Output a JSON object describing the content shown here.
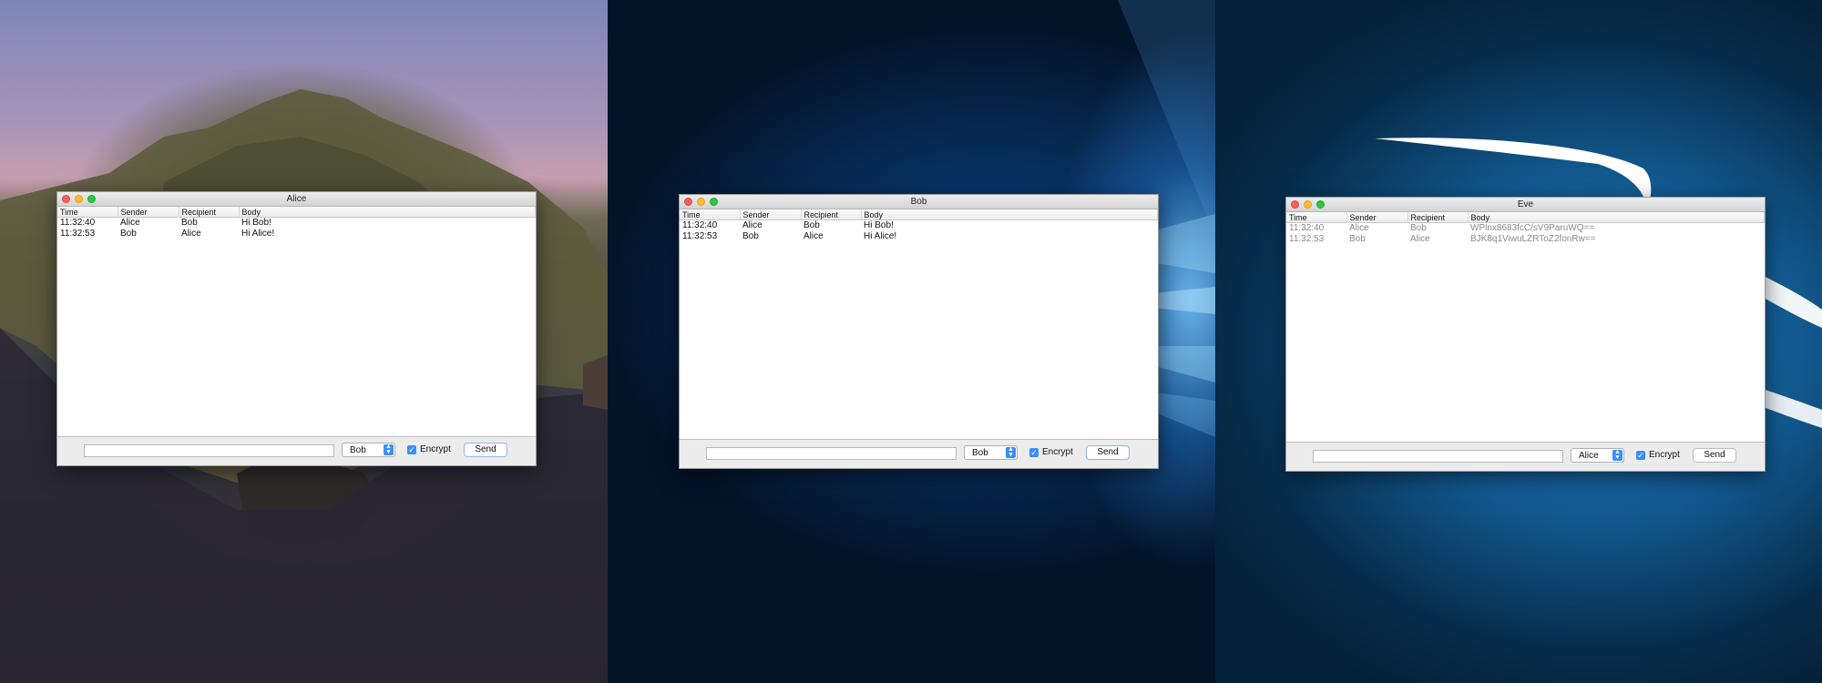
{
  "columns": [
    "Time",
    "Sender",
    "Recipient",
    "Body"
  ],
  "windows": {
    "alice": {
      "title": "Alice",
      "messages": [
        {
          "time": "11:32:40",
          "sender": "Alice",
          "recipient": "Bob",
          "body": "Hi Bob!"
        },
        {
          "time": "11:32:53",
          "sender": "Bob",
          "recipient": "Alice",
          "body": "Hi Alice!"
        }
      ],
      "input_value": "",
      "recipient_select": "Bob",
      "encrypt_label": "Encrypt",
      "encrypt_checked": true,
      "send_label": "Send"
    },
    "bob": {
      "title": "Bob",
      "messages": [
        {
          "time": "11:32:40",
          "sender": "Alice",
          "recipient": "Bob",
          "body": "Hi Bob!"
        },
        {
          "time": "11:32:53",
          "sender": "Bob",
          "recipient": "Alice",
          "body": "Hi Alice!"
        }
      ],
      "input_value": "",
      "recipient_select": "Bob",
      "encrypt_label": "Encrypt",
      "encrypt_checked": true,
      "send_label": "Send"
    },
    "eve": {
      "title": "Eve",
      "messages": [
        {
          "time": "11:32:40",
          "sender": "Alice",
          "recipient": "Bob",
          "body": "WPlnx8683fcC/sV9ParuWQ=="
        },
        {
          "time": "11:32:53",
          "sender": "Bob",
          "recipient": "Alice",
          "body": "BJK8q1ViwuLZRToZ2fonRw=="
        }
      ],
      "input_value": "",
      "recipient_select": "Alice",
      "encrypt_label": "Encrypt",
      "encrypt_checked": true,
      "send_label": "Send"
    }
  },
  "icons": {
    "close": "close-traffic-light-icon",
    "minimize": "minimize-traffic-light-icon",
    "zoom": "zoom-traffic-light-icon",
    "select_arrows": "chevron-updown-icon",
    "checkbox": "checkmark-icon"
  },
  "colors": {
    "close": "#fc5f57",
    "minimize": "#fdbc2e",
    "zoom": "#28c840",
    "accent": "#3b8ff6"
  }
}
